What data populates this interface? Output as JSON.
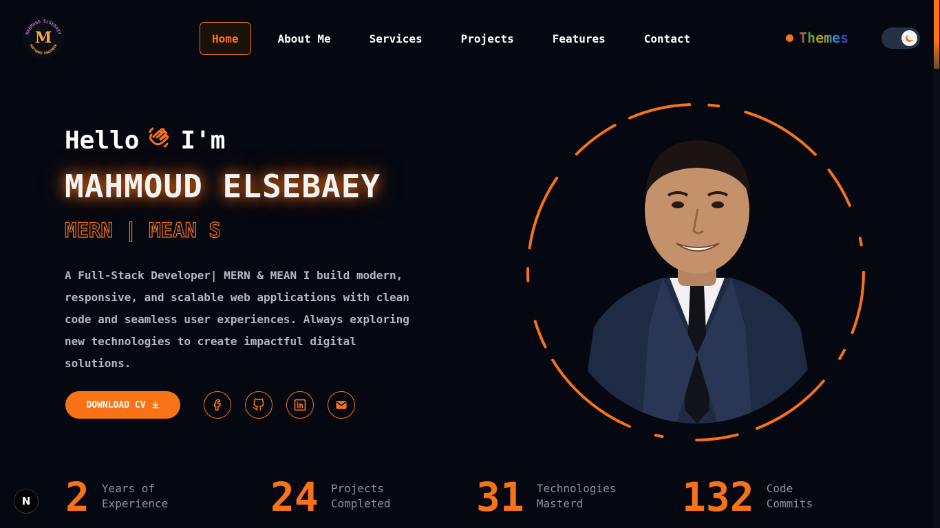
{
  "logo": {
    "monogram": "M",
    "ring_text_top": "MAHMOUD ELSEBAEY",
    "ring_text_bottom": "SOFTWARE ENGINEER"
  },
  "nav": {
    "items": [
      {
        "label": "Home",
        "active": true
      },
      {
        "label": "About Me",
        "active": false
      },
      {
        "label": "Services",
        "active": false
      },
      {
        "label": "Projects",
        "active": false
      },
      {
        "label": "Features",
        "active": false
      },
      {
        "label": "Contact",
        "active": false
      }
    ]
  },
  "themes": {
    "label": "Themes"
  },
  "hero": {
    "hello": "Hello",
    "im": "I'm",
    "name": "MAHMOUD ELSEBAEY",
    "role": "MERN | MEAN S",
    "bio": "A Full-Stack Developer| MERN & MEAN I build modern, responsive, and scalable web applications with clean code and seamless user experiences. Always exploring new technologies to create impactful digital solutions.",
    "cv_button": "DOWNLOAD CV",
    "socials": [
      "facebook-icon",
      "github-icon",
      "linkedin-icon",
      "mail-icon"
    ]
  },
  "stats": [
    {
      "value": "2",
      "line1": "Years of",
      "line2": "Experience"
    },
    {
      "value": "24",
      "line1": "Projects",
      "line2": "Completed"
    },
    {
      "value": "31",
      "line1": "Technologies",
      "line2": "Masterd"
    },
    {
      "value": "132",
      "line1": "Code",
      "line2": "Commits"
    }
  ],
  "badge": {
    "label": "N"
  },
  "colors": {
    "accent": "#f97316",
    "background": "#050811",
    "text_muted": "#b6b9c4"
  }
}
